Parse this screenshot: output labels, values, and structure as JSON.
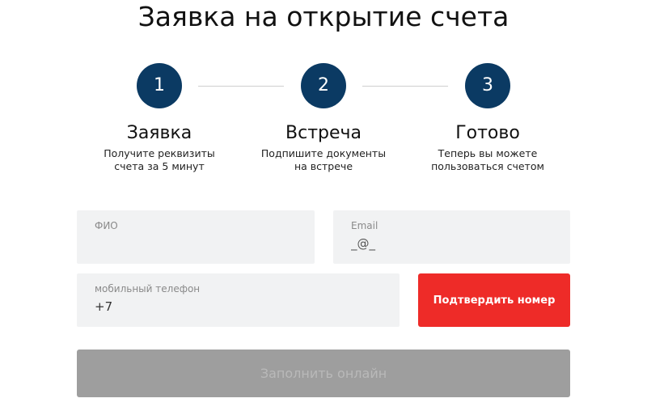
{
  "page": {
    "title": "Заявка на открытие счета"
  },
  "steps": [
    {
      "number": "1",
      "title": "Заявка",
      "description": "Получите реквизиты\nсчета за 5 минут"
    },
    {
      "number": "2",
      "title": "Встреча",
      "description": "Подпишите документы\nна встрече"
    },
    {
      "number": "3",
      "title": "Готово",
      "description": "Теперь вы можете\nпользоваться счетом"
    }
  ],
  "form": {
    "fio": {
      "label": "ФИО",
      "value": ""
    },
    "email": {
      "label": "Email",
      "placeholder": "_@_"
    },
    "phone": {
      "label": "мобильный телефон",
      "value": "+7"
    },
    "confirm_button": "Подтвердить номер",
    "fill_online_button": "Заполнить онлайн"
  },
  "colors": {
    "step_circle": "#0b3a63",
    "confirm_button": "#ee2b28",
    "disabled_button": "#9e9e9e",
    "field_background": "#f1f2f3"
  }
}
